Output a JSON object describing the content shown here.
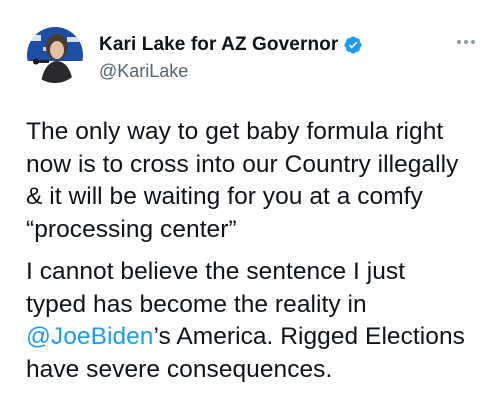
{
  "tweet": {
    "display_name": "Kari Lake for AZ Governor",
    "handle": "@KariLake",
    "paragraph1_lines": [
      "The only way to get baby formula right",
      "now is to cross into our Country illegally",
      "& it will be waiting for you at a comfy",
      "“processing center”"
    ],
    "paragraph2": {
      "line1": "I cannot believe the sentence I just",
      "line2": "typed has become the reality in",
      "mention": "@JoeBiden",
      "line3_rest": "’s America. Rigged Elections",
      "line4": "have severe consequences."
    }
  },
  "colors": {
    "text": "#0f1419",
    "secondary": "#536471",
    "link": "#1d9bf0",
    "verified_badge": "#1d9bf0"
  },
  "icons": {
    "verified": "verified-badge-icon",
    "more": "more-options-icon"
  }
}
